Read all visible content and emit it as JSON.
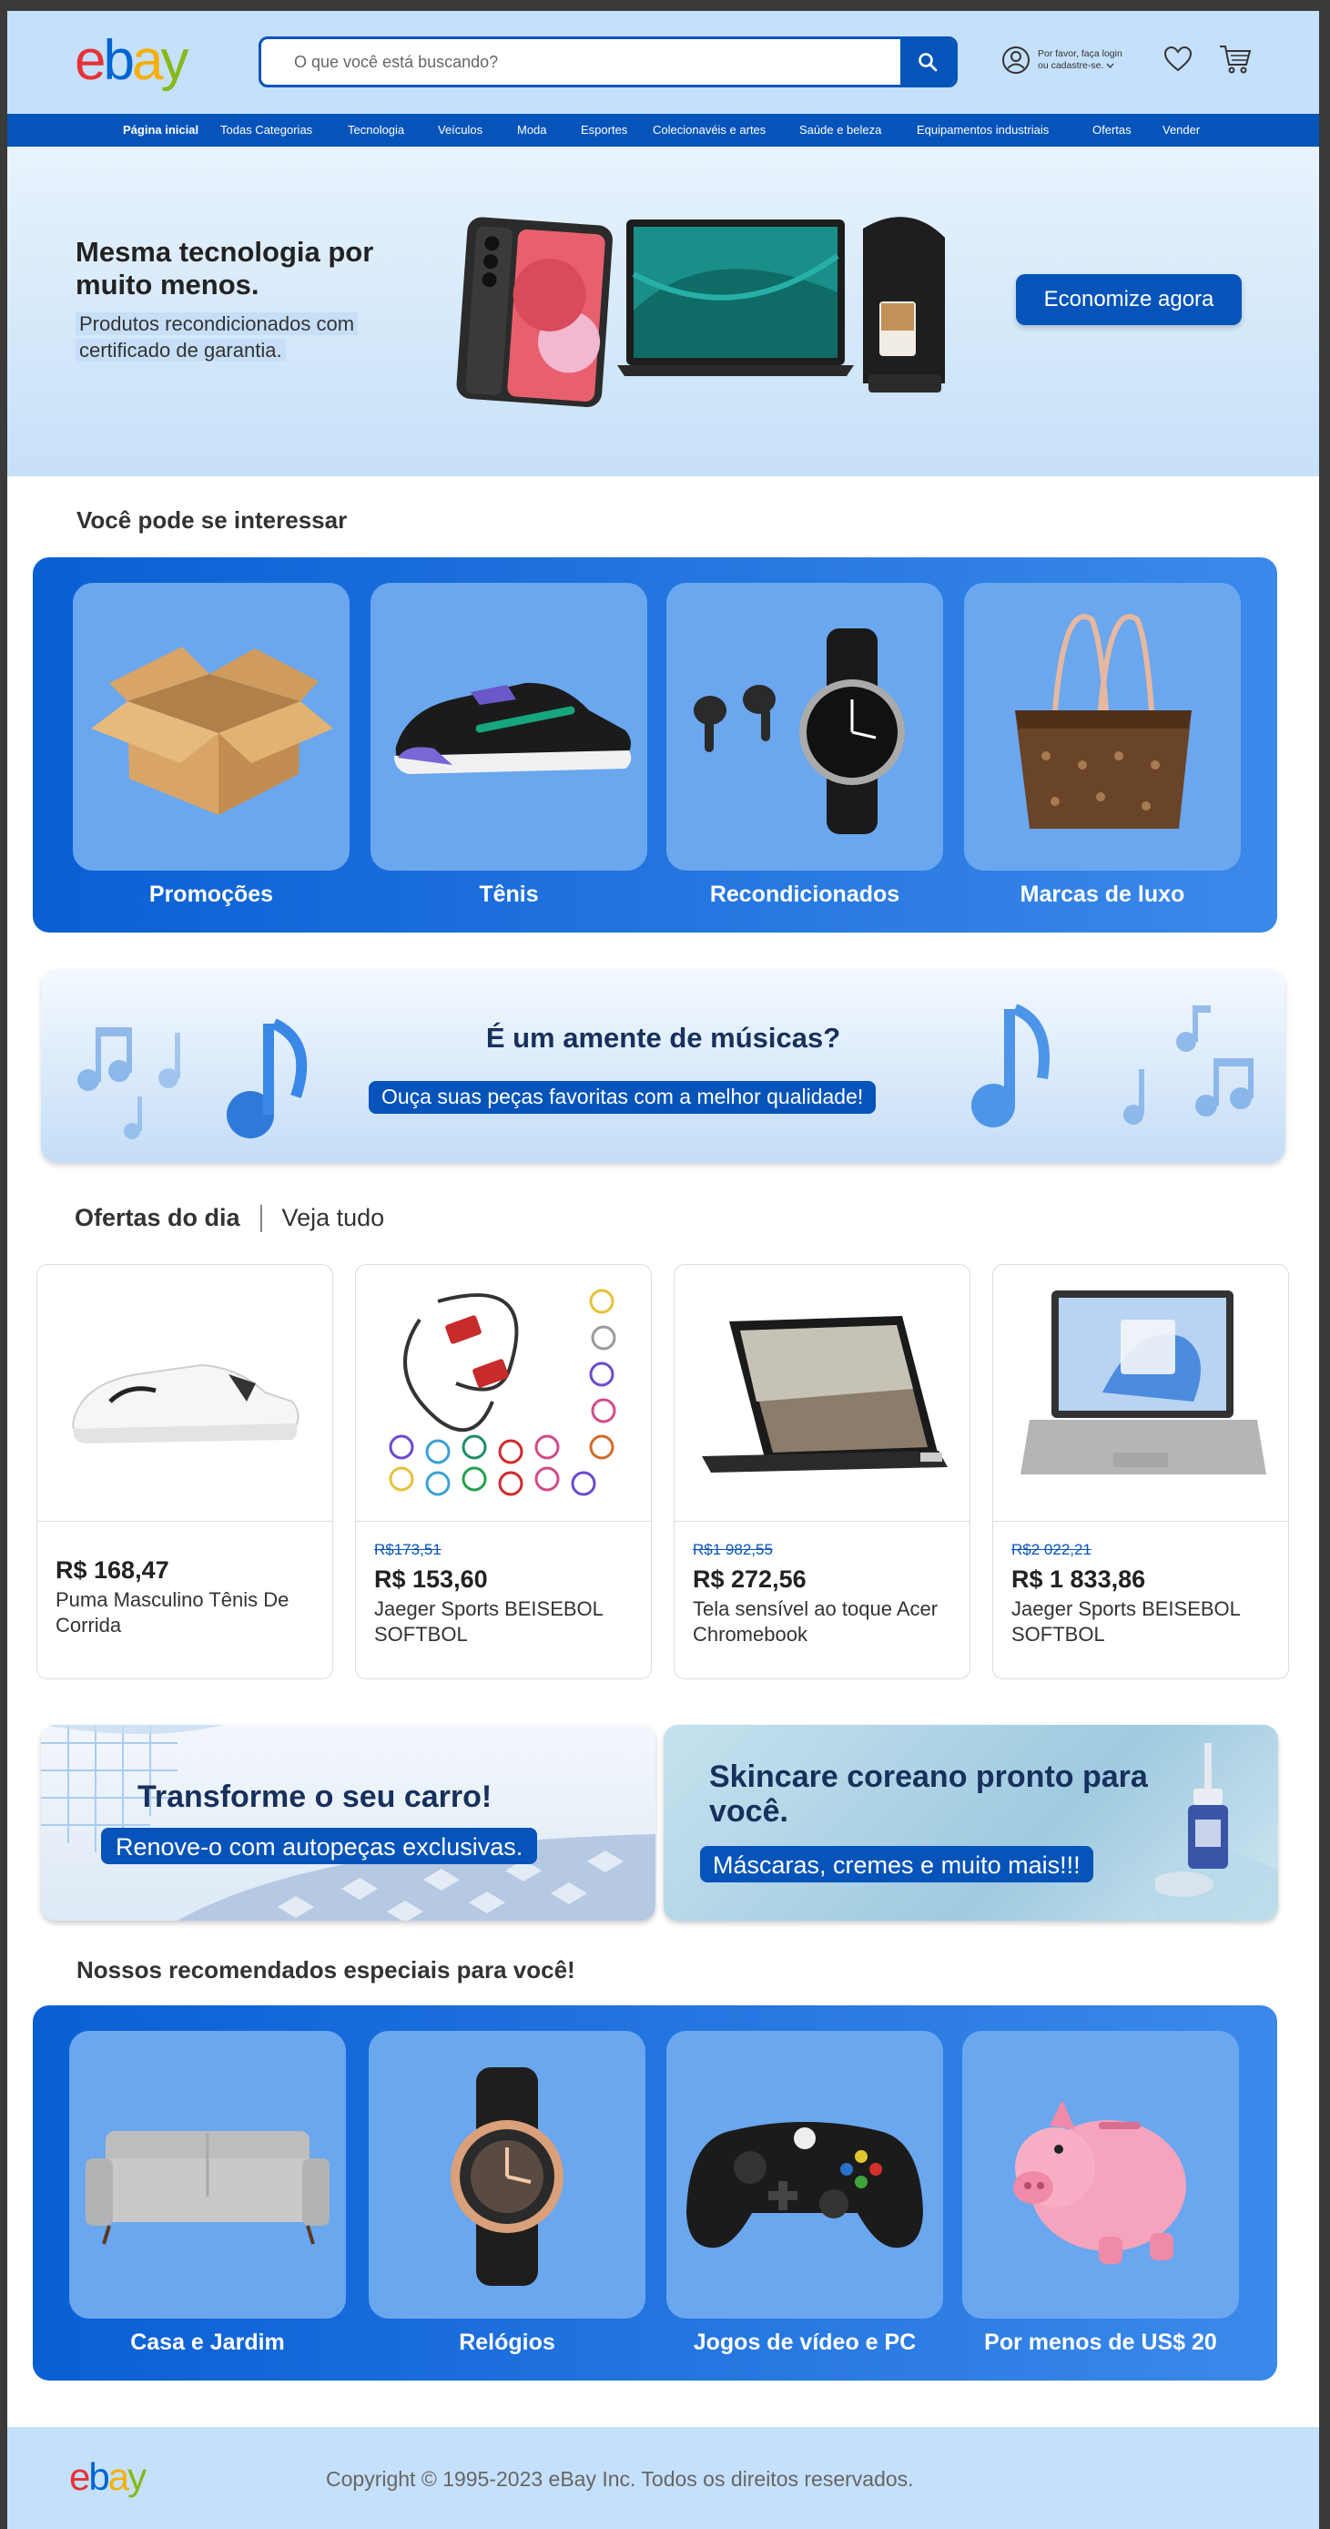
{
  "header": {
    "search_placeholder": "O que você está buscando?",
    "account_line1": "Por favor, faça login",
    "account_line2": "ou cadastre-se."
  },
  "nav": [
    "Página inicial",
    "Todas Categorias",
    "Tecnologia",
    "Veículos",
    "Moda",
    "Esportes",
    "Colecionavéis e artes",
    "Saúde e beleza",
    "Equipamentos industriais",
    "Ofertas",
    "Vender"
  ],
  "hero": {
    "title": "Mesma tecnologia por muito menos.",
    "subtitle": "Produtos recondicionados com certificado de garantia.",
    "button": "Economize agora"
  },
  "interest": {
    "title": "Você pode se interessar",
    "items": [
      "Promoções",
      "Tênis",
      "Recondicionados",
      "Marcas de luxo"
    ]
  },
  "music_banner": {
    "title": "É um amente de músicas?",
    "subtitle": "Ouça suas peças favoritas com a melhor qualidade!"
  },
  "deals": {
    "title": "Ofertas do dia",
    "see_all": "Veja tudo",
    "items": [
      {
        "old_price": "",
        "price": "R$ 168,47",
        "name": "Puma Masculino Tênis De Corrida"
      },
      {
        "old_price": "R$173,51",
        "price": "R$ 153,60",
        "name": "Jaeger Sports BEISEBOL SOFTBOL"
      },
      {
        "old_price": "R$1 982,55",
        "price": "R$ 272,56",
        "name": "Tela sensível ao toque Acer Chromebook"
      },
      {
        "old_price": "R$2 022,21",
        "price": "R$ 1 833,86",
        "name": "Jaeger Sports BEISEBOL SOFTBOL"
      }
    ]
  },
  "promo_car": {
    "title": "Transforme o seu carro!",
    "subtitle": "Renove-o com autopeças exclusivas."
  },
  "promo_skin": {
    "title": "Skincare coreano pronto para você.",
    "subtitle": "Máscaras, cremes e muito mais!!!"
  },
  "recommended": {
    "title": "Nossos recomendados especiais para você!",
    "items": [
      "Casa e Jardim",
      "Relógios",
      "Jogos de vídeo e PC",
      "Por menos de US$ 20"
    ]
  },
  "footer": {
    "copyright": "Copyright © 1995-2023 eBay Inc. Todos os direitos reservados."
  },
  "logo": {
    "letters": [
      "e",
      "b",
      "a",
      "y"
    ]
  },
  "colors": {
    "brand_blue": "#0654ba",
    "header_bg": "#c5e0fa",
    "logo_e": "#e53238",
    "logo_b": "#0064d2",
    "logo_a": "#f5af02",
    "logo_y": "#86b817"
  }
}
